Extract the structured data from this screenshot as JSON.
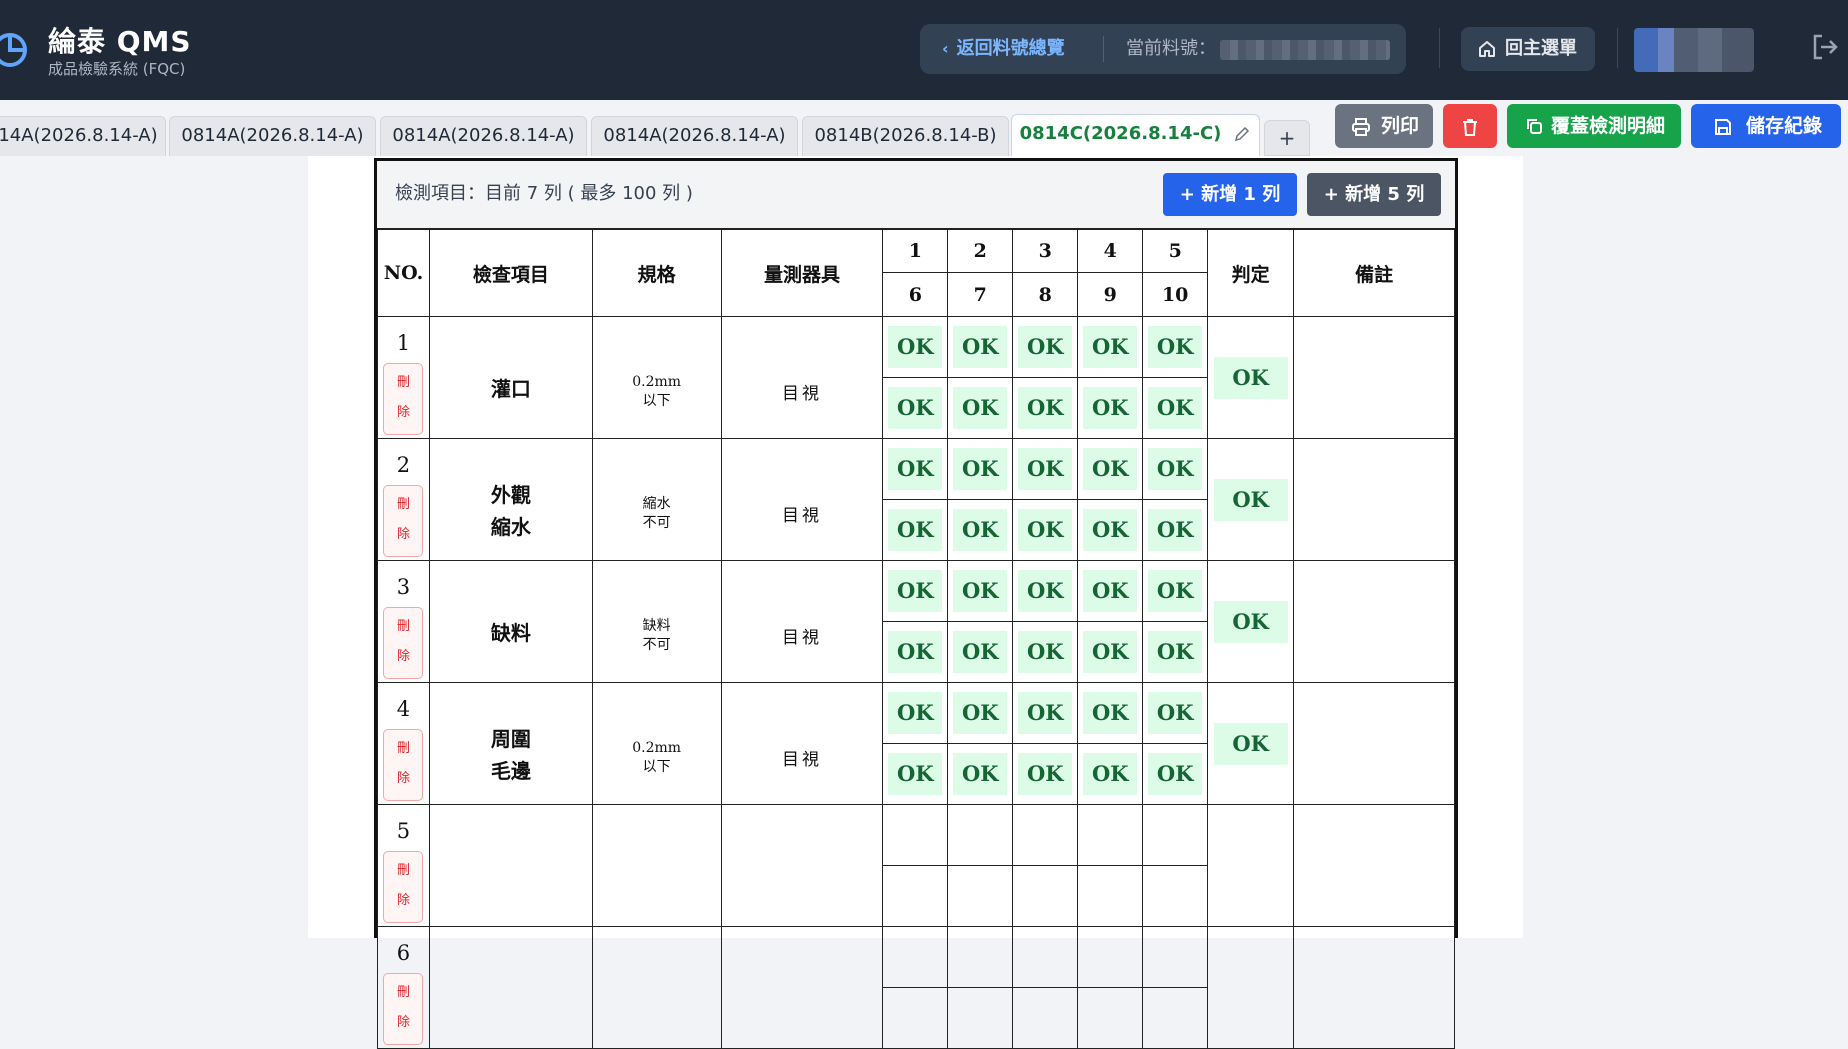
{
  "app": {
    "title": "綸泰 QMS",
    "subtitle": "成品檢驗系統 (FQC)"
  },
  "header": {
    "back_label": "返回料號總覽",
    "current_part_label": "當前料號：",
    "home_label": "回主選單"
  },
  "tabs": [
    {
      "label": "14A(2026.8.14-A)"
    },
    {
      "label": "0814A(2026.8.14-A)"
    },
    {
      "label": "0814A(2026.8.14-A)"
    },
    {
      "label": "0814A(2026.8.14-A)"
    },
    {
      "label": "0814B(2026.8.14-B)"
    },
    {
      "label": "0814C(2026.8.14-C)",
      "active": true
    }
  ],
  "tab_add_label": "+",
  "actions": {
    "print_label": "列印",
    "copy_label": "覆蓋檢測明細",
    "save_label": "儲存紀錄"
  },
  "toolbar": {
    "label": "檢測項目：目前 7 列 ( 最多 100 列 )",
    "add_one_label": "+ 新增 1 列",
    "add_five_label": "+ 新增 5 列"
  },
  "table": {
    "headers": {
      "no": "NO.",
      "item": "檢查項目",
      "spec": "規格",
      "tool": "量測器具",
      "verdict": "判定",
      "note": "備註"
    },
    "cols_top": [
      "1",
      "2",
      "3",
      "4",
      "5"
    ],
    "cols_bottom": [
      "6",
      "7",
      "8",
      "9",
      "10"
    ],
    "delete_label": "刪\n除",
    "rows": [
      {
        "no": "1",
        "item": "灌口",
        "spec": "0.2mm\n以下",
        "tool": "目視",
        "values": [
          "OK",
          "OK",
          "OK",
          "OK",
          "OK",
          "OK",
          "OK",
          "OK",
          "OK",
          "OK"
        ],
        "verdict": "OK",
        "note": ""
      },
      {
        "no": "2",
        "item": "外觀\n縮水",
        "spec": "縮水\n不可",
        "tool": "目視",
        "values": [
          "OK",
          "OK",
          "OK",
          "OK",
          "OK",
          "OK",
          "OK",
          "OK",
          "OK",
          "OK"
        ],
        "verdict": "OK",
        "note": ""
      },
      {
        "no": "3",
        "item": "缺料",
        "spec": "缺料\n不可",
        "tool": "目視",
        "values": [
          "OK",
          "OK",
          "OK",
          "OK",
          "OK",
          "OK",
          "OK",
          "OK",
          "OK",
          "OK"
        ],
        "verdict": "OK",
        "note": ""
      },
      {
        "no": "4",
        "item": "周圍\n毛邊",
        "spec": "0.2mm\n以下",
        "tool": "目視",
        "values": [
          "OK",
          "OK",
          "OK",
          "OK",
          "OK",
          "OK",
          "OK",
          "OK",
          "OK",
          "OK"
        ],
        "verdict": "OK",
        "note": ""
      },
      {
        "no": "5",
        "item": "",
        "spec": "",
        "tool": "",
        "values": [
          "",
          "",
          "",
          "",
          "",
          "",
          "",
          "",
          "",
          ""
        ],
        "verdict": "",
        "note": ""
      },
      {
        "no": "6",
        "item": "",
        "spec": "",
        "tool": "",
        "values": [
          "",
          "",
          "",
          "",
          "",
          "",
          "",
          "",
          "",
          ""
        ],
        "verdict": "",
        "note": ""
      }
    ]
  },
  "colors": {
    "header_bg": "#1f2937",
    "accent_blue": "#2563eb",
    "ok_bg": "#dcfce7",
    "ok_text": "#166534",
    "active_tab": "#16803c"
  }
}
